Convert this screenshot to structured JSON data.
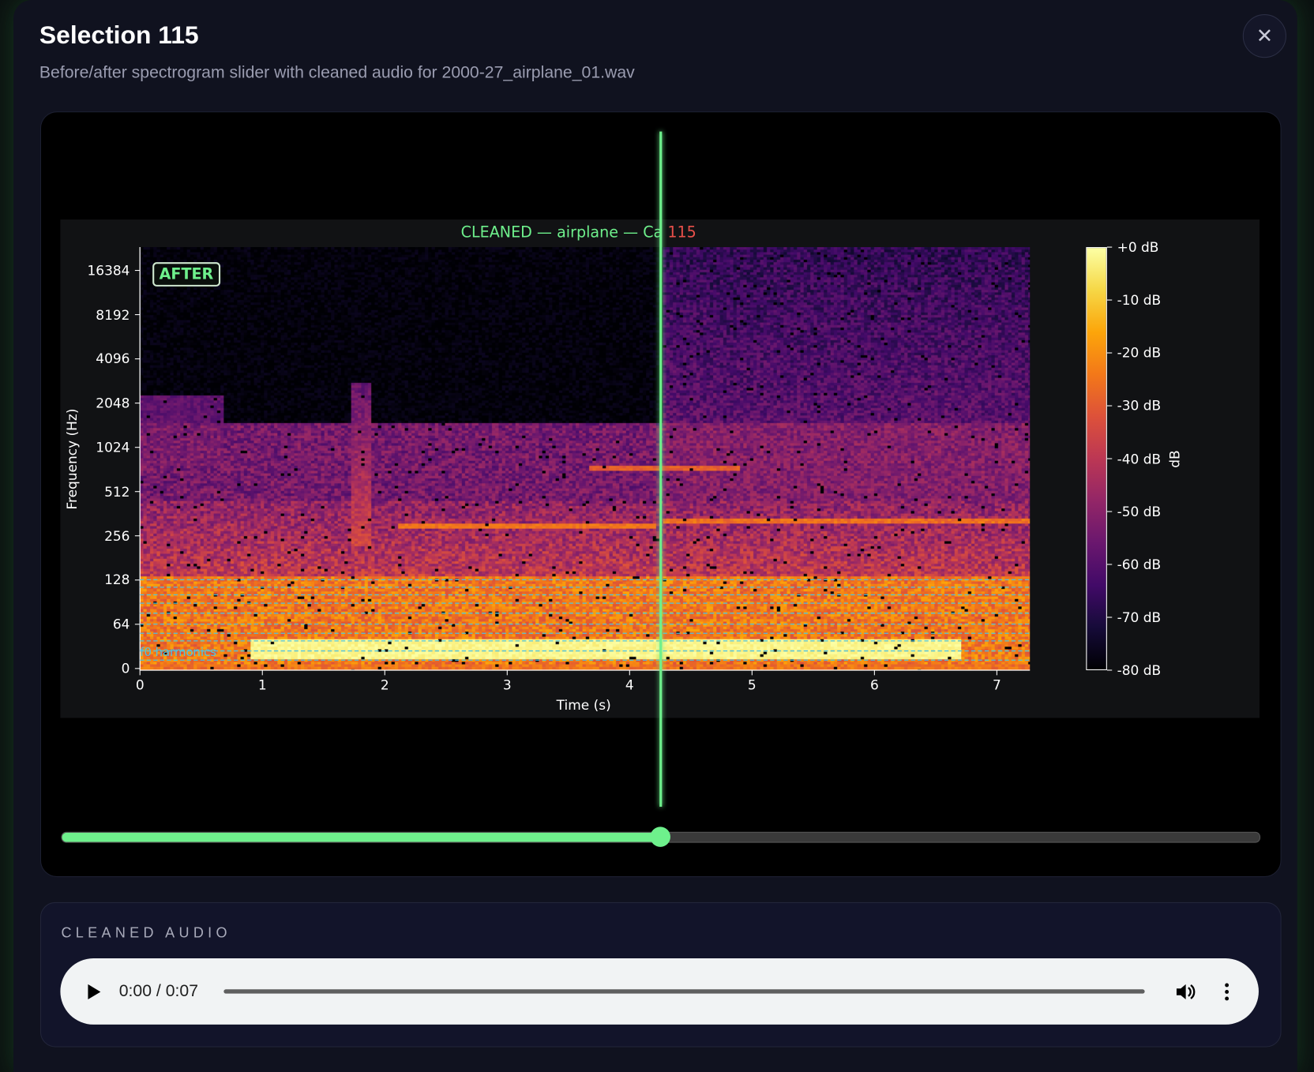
{
  "modal": {
    "title": "Selection 115",
    "subtitle": "Before/after spectrogram slider with cleaned audio for 2000-27_airplane_01.wav",
    "close_icon": "close-icon"
  },
  "comparison": {
    "badge": "AFTER",
    "slider_percent": 50,
    "accent_color": "#6ef08c"
  },
  "chart_data": {
    "type": "heatmap",
    "title_visible": "CLEANED — airplane — Ca",
    "title_visible_red": "115",
    "xlabel": "Time (s)",
    "ylabel": "Frequency (Hz)",
    "x_ticks": [
      "0",
      "1",
      "2",
      "3",
      "4",
      "5",
      "6",
      "7"
    ],
    "xlim": [
      0,
      7.27
    ],
    "y_ticks": [
      "0",
      "64",
      "128",
      "256",
      "512",
      "1024",
      "2048",
      "4096",
      "8192",
      "16384"
    ],
    "y_scale": "log2 (symlog)",
    "colormap": "inferno",
    "colorbar_label": "dB",
    "colorbar_ticks": [
      "+0 dB",
      "-10 dB",
      "-20 dB",
      "-30 dB",
      "-40 dB",
      "-50 dB",
      "-60 dB",
      "-70 dB",
      "-80 dB"
    ],
    "clim": [
      -80,
      0
    ],
    "annotation": "f0 harmonics",
    "overlay_color": "#4fc3e0"
  },
  "audio": {
    "section_label": "CLEANED AUDIO",
    "time": "0:00 / 0:07",
    "progress_percent": 0
  }
}
